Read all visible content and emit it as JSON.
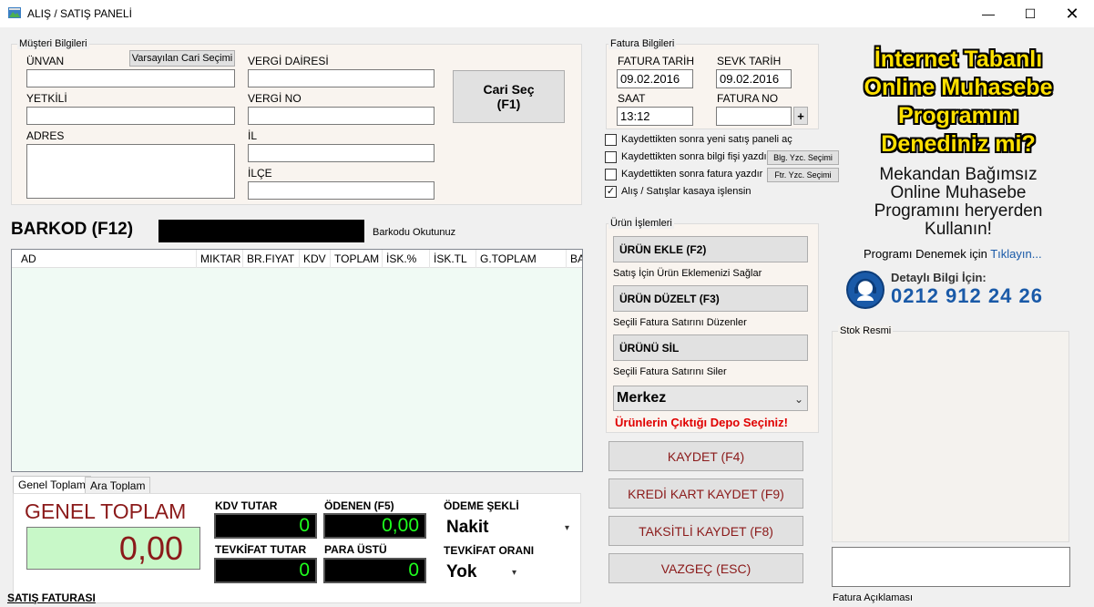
{
  "window": {
    "title": "ALIŞ / SATIŞ PANELİ"
  },
  "customer": {
    "group_title": "Müşteri Bilgileri",
    "default_button": "Varsayılan Cari Seçimi",
    "unvan_label": "ÜNVAN",
    "yetkili_label": "YETKİLİ",
    "adres_label": "ADRES",
    "vergi_dairesi_label": "VERGİ DAİRESİ",
    "vergi_no_label": "VERGİ NO",
    "il_label": "İL",
    "ilce_label": "İLÇE",
    "cari_sec_button": "Cari Seç\n(F1)",
    "unvan_value": "",
    "yetkili_value": "",
    "adres_value": "",
    "vergi_dairesi_value": "",
    "vergi_no_value": "",
    "il_value": "",
    "ilce_value": ""
  },
  "invoice": {
    "group_title": "Fatura Bilgileri",
    "fatura_tarih_label": "FATURA TARİH",
    "fatura_tarih_value": "09.02.2016",
    "sevk_tarih_label": "SEVK TARİH",
    "sevk_tarih_value": "09.02.2016",
    "saat_label": "SAAT",
    "saat_value": "13:12",
    "fatura_no_label": "FATURA NO",
    "fatura_no_value": "",
    "plus_button": "+"
  },
  "options": [
    {
      "label": "Kaydettikten sonra yeni satış paneli aç",
      "checked": false,
      "button": ""
    },
    {
      "label": "Kaydettikten sonra bilgi fişi yazdır",
      "checked": false,
      "button": "Blg. Yzc. Seçimi"
    },
    {
      "label": "Kaydettikten sonra fatura yazdır",
      "checked": false,
      "button": "Ftr. Yzc. Seçimi"
    },
    {
      "label": "Alış / Satışlar kasaya işlensin",
      "checked": true,
      "button": ""
    }
  ],
  "barcode": {
    "title": "BARKOD (F12)",
    "hint": "Barkodu Okutunuz",
    "value": ""
  },
  "grid": {
    "columns": [
      "AD",
      "MIKTAR",
      "BR.FIYAT",
      "KDV",
      "TOPLAM",
      "İSK.%",
      "İSK.TL",
      "G.TOPLAM",
      "BA"
    ]
  },
  "product_ops": {
    "group_title": "Ürün İşlemleri",
    "add_button": "ÜRÜN EKLE (F2)",
    "add_desc": "Satış İçin Ürün Eklemenizi Sağlar",
    "edit_button": "ÜRÜN DÜZELT (F3)",
    "edit_desc": "Seçili Fatura Satırını Düzenler",
    "delete_button": "ÜRÜNÜ SİL",
    "delete_desc": "Seçili Fatura Satırını Siler",
    "depot_value": "Merkez",
    "depot_warning": "Ürünlerin Çıktığı Depo Seçiniz!"
  },
  "actions": {
    "save": "KAYDET (F4)",
    "card_save": "KREDİ KART KAYDET (F9)",
    "installment_save": "TAKSİTLİ KAYDET (F8)",
    "cancel": "VAZGEÇ (ESC)"
  },
  "totals": {
    "tab_general": "Genel Toplam",
    "tab_sub": "Ara Toplam",
    "general_total_label": "GENEL TOPLAM",
    "general_total_value": "0,00",
    "kdv_label": "KDV TUTAR",
    "kdv_value": "0",
    "paid_label": "ÖDENEN (F5)",
    "paid_value": "0,00",
    "payment_type_label": "ÖDEME ŞEKLİ",
    "payment_type_value": "Nakit",
    "tevkifat_label": "TEVKİFAT TUTAR",
    "tevkifat_value": "0",
    "change_label": "PARA ÜSTÜ",
    "change_value": "0",
    "tevkifat_rate_label": "TEVKİFAT ORANI",
    "tevkifat_rate_value": "Yok"
  },
  "footer": {
    "invoice_type": "SATIŞ FATURASI"
  },
  "ad": {
    "title_lines": [
      "İnternet Tabanlı",
      "Online Muhasebe",
      "Programını",
      "Denediniz mi?"
    ],
    "sub_lines": [
      "Mekandan Bağımsız",
      "Online Muhasebe",
      "Programını heryerden",
      "Kullanın!"
    ],
    "try_text": "Programı Denemek için",
    "try_link": "Tıklayın...",
    "info_label": "Detaylı Bilgi İçin:",
    "phone": "0212 912 24 26"
  },
  "stock": {
    "group_title": "Stok Resmi",
    "notes_label": "Fatura Açıklaması",
    "notes_value": ""
  }
}
